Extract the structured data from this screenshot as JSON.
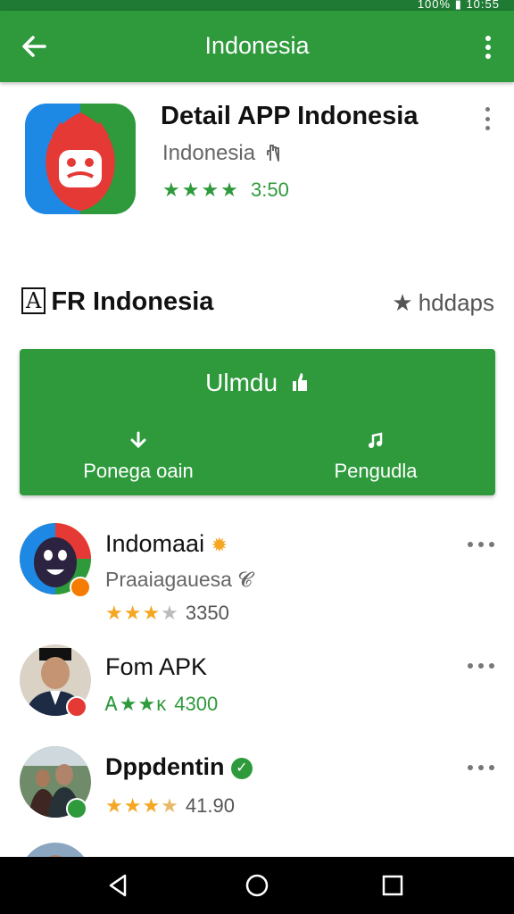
{
  "status_bar": {
    "text": "100% ▮ 10:55"
  },
  "app_bar": {
    "title": "Indonesia",
    "back_icon": "arrow-left-icon",
    "menu_icon": "more-vert-icon"
  },
  "app_header": {
    "title": "Detail APP Indonesia",
    "subtitle": "Indonesia",
    "subtitle_icon": "hand-icon",
    "stars": "★★★★",
    "rating": "3:50",
    "accent_color": "#2e9a3c"
  },
  "section": {
    "title": "FR Indonesia",
    "logo_letter": "A",
    "link_label": "hddaps",
    "link_icon": "star-icon"
  },
  "install": {
    "main_label": "Ulmdu",
    "main_icon": "thumb-icon",
    "left_label": "Ponega oain",
    "left_icon": "download-icon",
    "right_label": "Pengudla",
    "right_icon": "music-note-icon"
  },
  "list": [
    {
      "title": "Indomaai",
      "subtitle": "Praaiagauesa",
      "stars": "★★★",
      "half_star": "★",
      "rating": "3350",
      "badge_icon": "sun-icon"
    },
    {
      "title": "Fom APK",
      "stars": "Ꭺ★★ᴋ",
      "rating": "4300",
      "badge_icon": "alert-icon"
    },
    {
      "title": "Dppdentin",
      "stars": "★★★",
      "half_star": "★",
      "rating": "41.90",
      "badge_icon": "verified-check-icon"
    }
  ],
  "nav": {
    "back": "nav-back-icon",
    "home": "nav-home-icon",
    "recents": "nav-recents-icon"
  }
}
